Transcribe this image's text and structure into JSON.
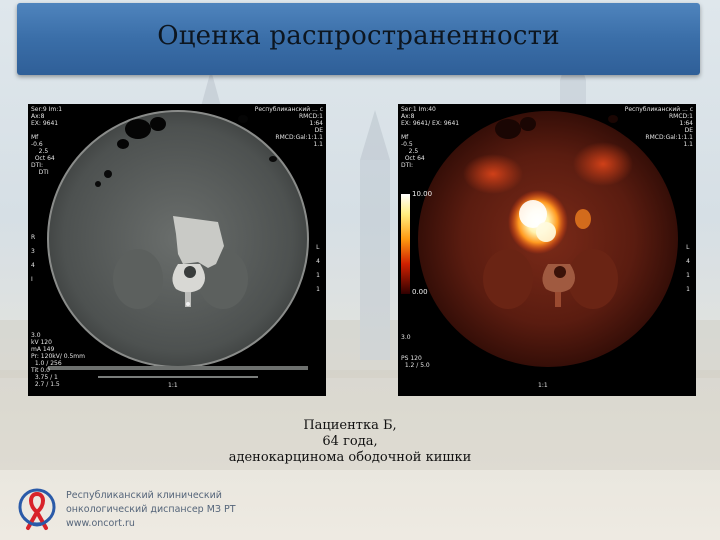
{
  "slide": {
    "title": "Оценка распространенности",
    "caption": {
      "line1": "Пациентка Б,",
      "line2": "64 года,",
      "line3": "аденокарцинома ободочной кишки"
    }
  },
  "ct_image": {
    "overlay": {
      "top_left": "Ser:9 Im:1\nAx:8\nEX: 9641\n\nMf\n-0.6\n    2.5\n  Oct 64\nDTI:\n    DTI\n",
      "top_right": "Республиканский ... с\nRMCD:1\n  1:64\nDE\n  RMCD:Gal:1:1.1\n    1.1",
      "left_mid": "R\n\n3\n\n4\n\nI",
      "right_mid": "L\n\n4\n\n1\n\n1",
      "bottom_left": "3.0\nkV 120\nmA 149\nPr: 120kV/ 0.5mm\n  1.0 / 256\nTit 0.0\n  3.75 / 1\n  2.7 / 1.5",
      "bottom_center": "1:1"
    }
  },
  "pet_image": {
    "overlay": {
      "top_left": "Ser:1 Im:40\nAx:8\nEX: 9641/ EX: 9641\n\nMf\n-0.5\n    2.5\n  Oct 64\nDTI:",
      "top_right": "Республиканский ... с\nRMCD:1\n  1:64\nDE\n  RMCD:Gal:1:1.1\n    1.1",
      "colorbar_max": "10.00",
      "colorbar_min": "0.00",
      "right_mid": "L\n\n4\n\n1\n\n1",
      "bottom_left": "3.0\n\n\nPS 120\n  1.2 / 5.0",
      "bottom_center": "1:1"
    }
  },
  "footer": {
    "org_line1": "Республиканский клинический",
    "org_line2": "онкологический диспансер МЗ РТ",
    "website": "www.oncort.ru"
  },
  "colors": {
    "title_bar": "#3a6ea8",
    "logo_red": "#d8232a",
    "logo_blue": "#2a5aa8",
    "org_text": "#55657a"
  }
}
